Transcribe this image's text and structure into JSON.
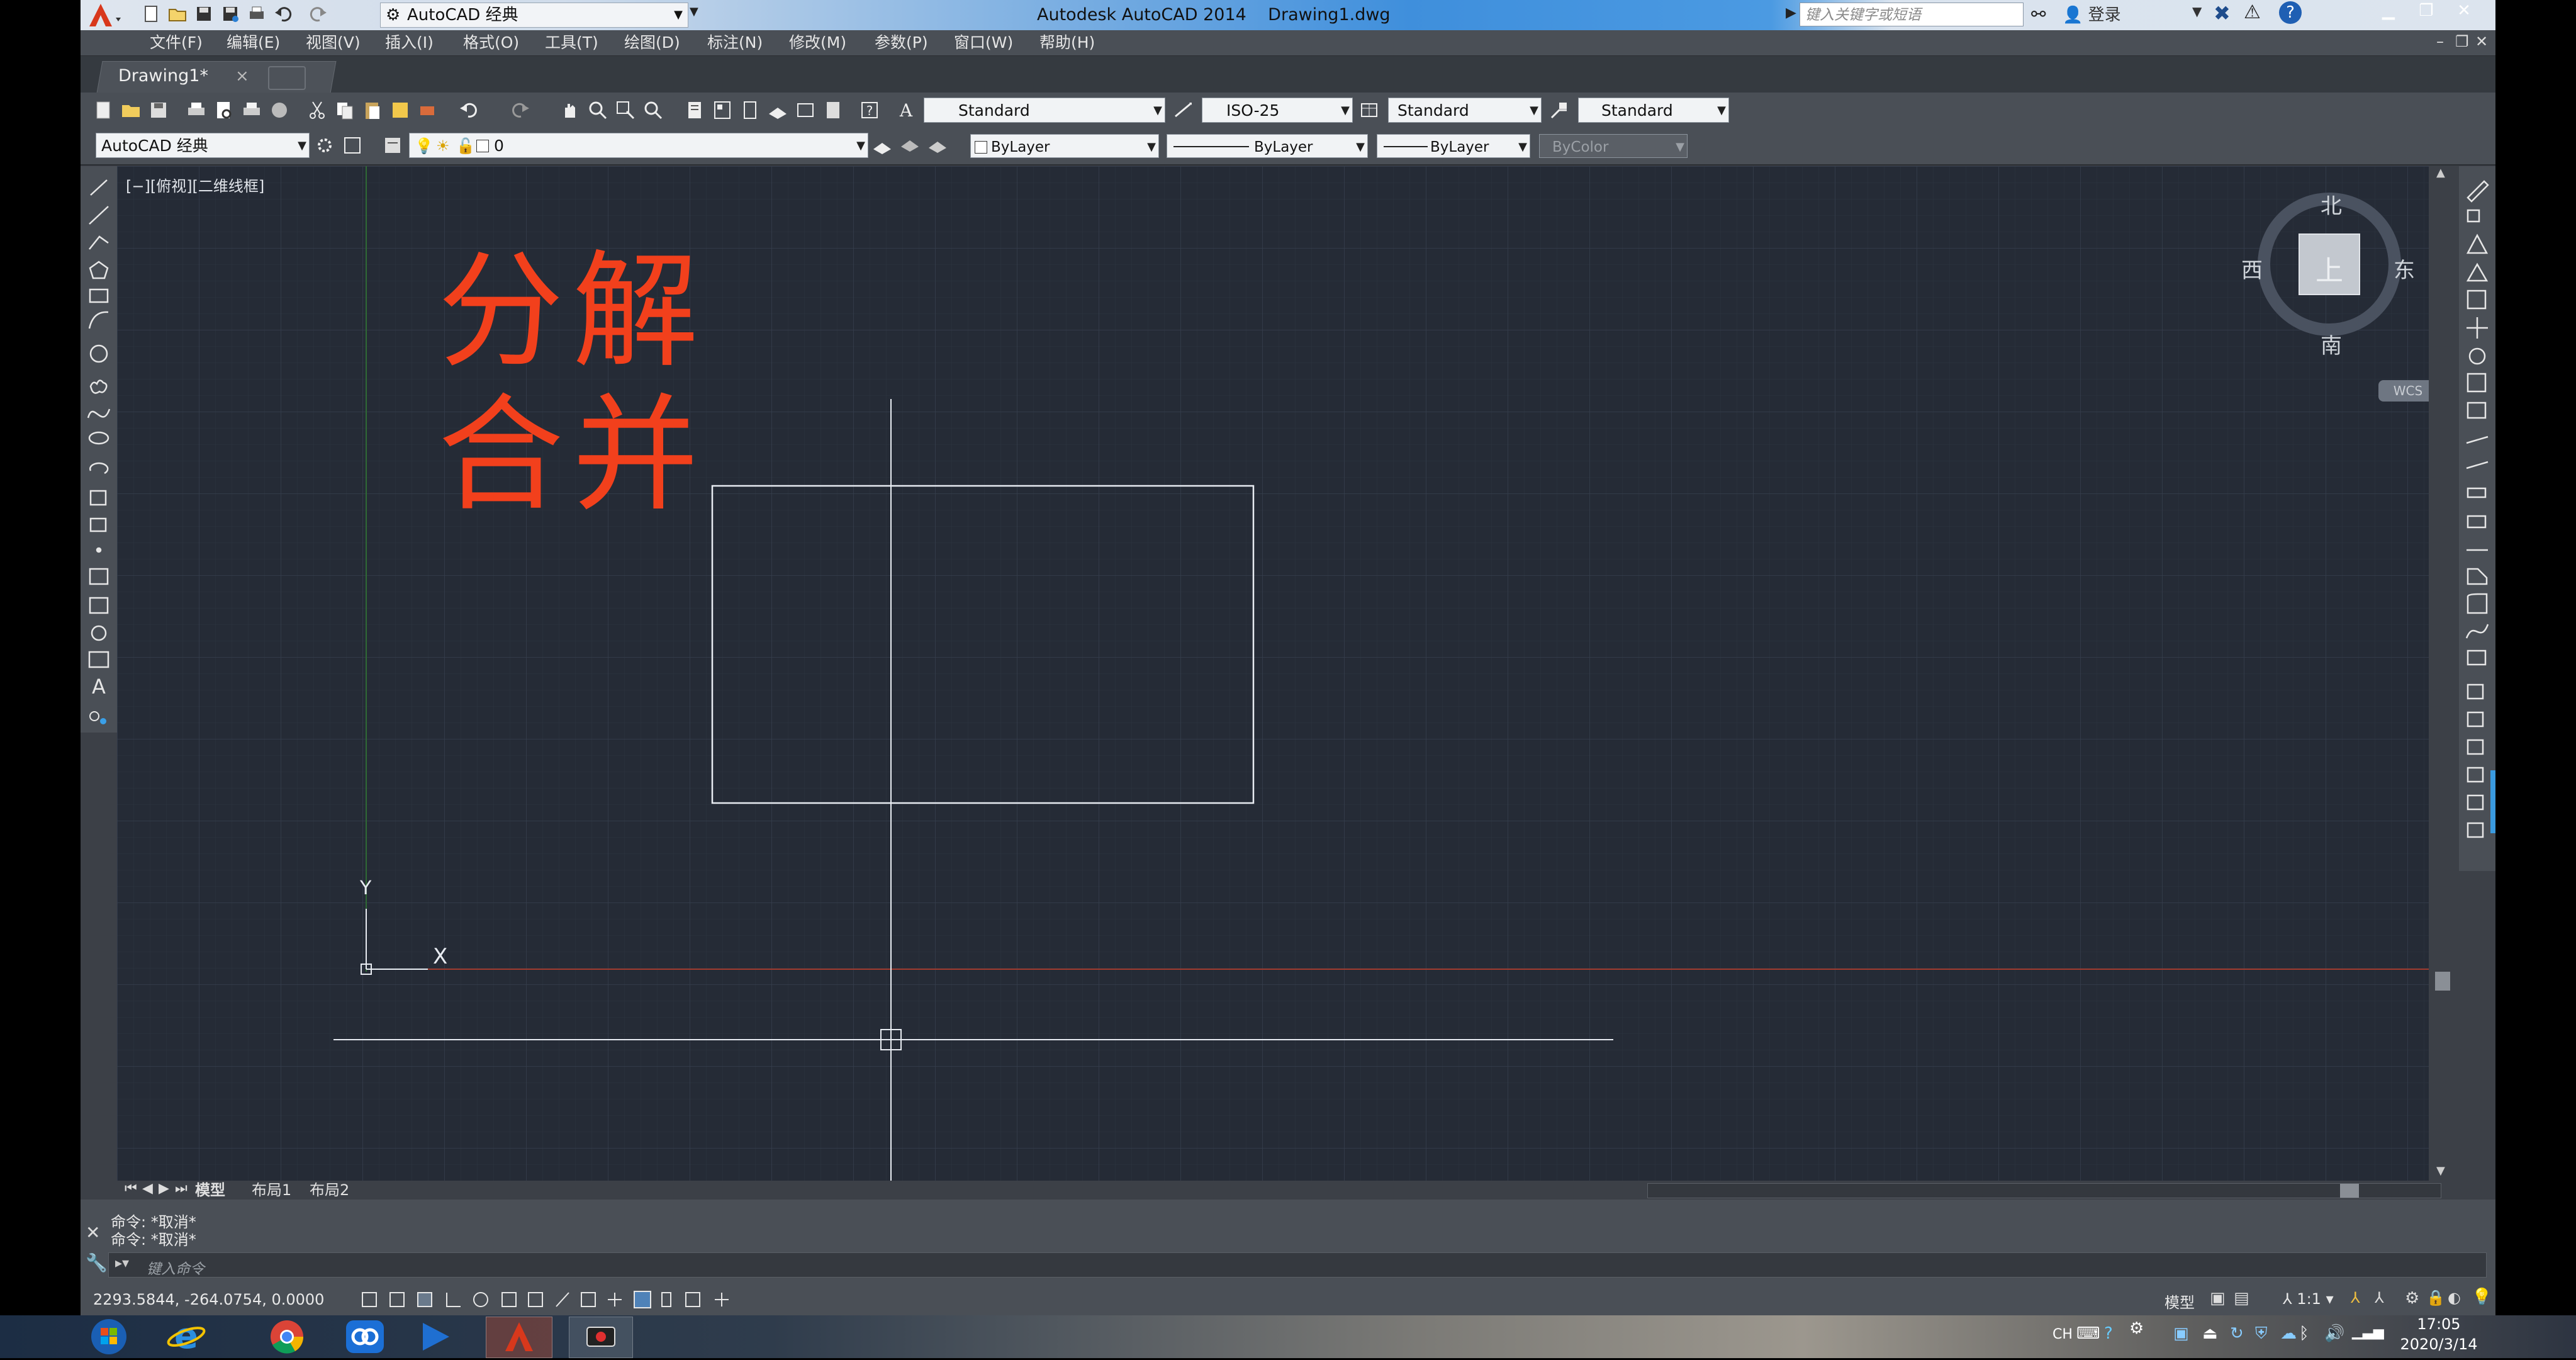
{
  "titlebar": {
    "workspace": "AutoCAD 经典",
    "app_title": "Autodesk AutoCAD 2014",
    "document_title": "Drawing1.dwg",
    "search_placeholder": "键入关键字或短语",
    "login": "登录",
    "colors": {
      "accent": "#3f8fdc"
    }
  },
  "menubar": {
    "items": [
      "文件(F)",
      "编辑(E)",
      "视图(V)",
      "插入(I)",
      "格式(O)",
      "工具(T)",
      "绘图(D)",
      "标注(N)",
      "修改(M)",
      "参数(P)",
      "窗口(W)",
      "帮助(H)"
    ]
  },
  "tabs": {
    "document": "Drawing1*",
    "close": "×"
  },
  "toolbar1": {
    "text_style": "Standard",
    "dim_style": "ISO-25",
    "table_style": "Standard",
    "mleader_style": "Standard"
  },
  "toolbar2": {
    "workspace": "AutoCAD 经典",
    "layer": "0",
    "color": "ByLayer",
    "linetype": "ByLayer",
    "lineweight": "ByLayer",
    "plotstyle": "ByColor"
  },
  "viewport": {
    "label": "[−][俯视][二维线框]",
    "annotation_line1": "分解",
    "annotation_line2": "合并",
    "ucs_x": "X",
    "ucs_y": "Y",
    "colors": {
      "background": "#252b36",
      "annotation": "#f2401c",
      "x_axis": "#a03a2e",
      "y_axis": "#2f6a35"
    }
  },
  "viewcube": {
    "north": "北",
    "south": "南",
    "east": "东",
    "west": "西",
    "face": "上",
    "wcs": "WCS"
  },
  "layout_tabs": [
    "模型",
    "布局1",
    "布局2"
  ],
  "command": {
    "history": [
      "命令: *取消*",
      "命令: *取消*"
    ],
    "placeholder": "键入命令"
  },
  "statusbar": {
    "coordinates": "2293.5844, -264.0754, 0.0000",
    "model_label": "模型",
    "scale": "1:1"
  },
  "taskbar": {
    "lang": "CH",
    "time": "17:05",
    "date": "2020/3/14",
    "apps": [
      "start-orb",
      "internet-explorer",
      "chrome",
      "baidu-netdisk",
      "media-player",
      "autocad",
      "screen-recorder"
    ]
  }
}
